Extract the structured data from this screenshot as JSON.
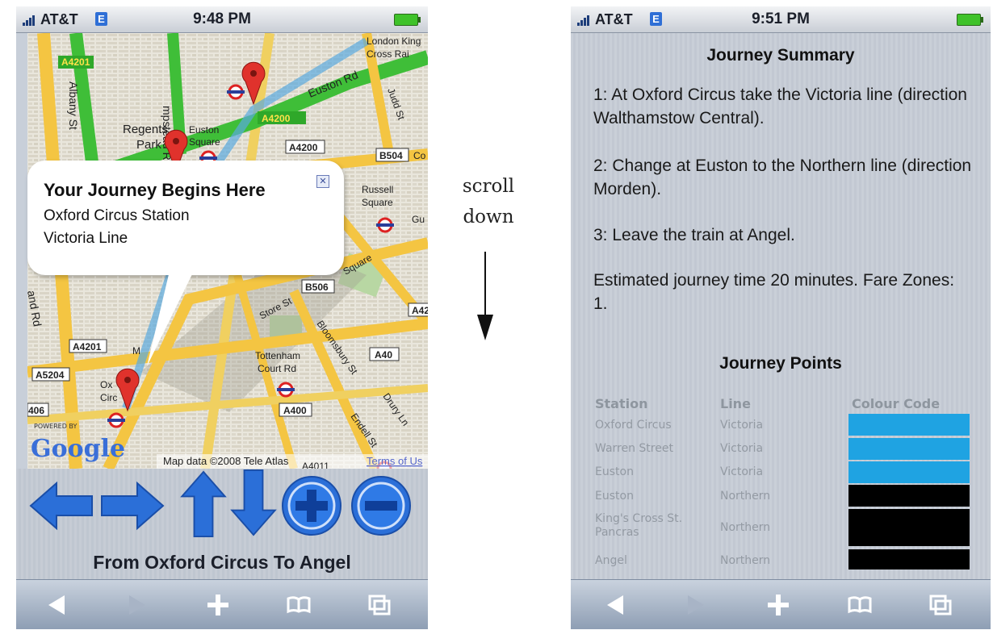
{
  "left_screen": {
    "status": {
      "carrier": "AT&T",
      "network": "E",
      "time": "9:48 PM"
    },
    "map_labels": {
      "a4201_top": "A4201",
      "hampstead": "mpstead Rd",
      "albany": "Albany St",
      "kings_cross": "London King",
      "kings_cross2": "Cross Rai",
      "euston_rd": "Euston Rd",
      "a4200_a": "A4200",
      "a4200_b": "A4200",
      "judd": "Judd St",
      "regents": "Regents",
      "park": "Park",
      "euston_sq": "Euston",
      "euston_sq2": "Square",
      "b504": "B504",
      "co": "Co",
      "russell": "Russell",
      "russell2": "Square",
      "gu": "Gu",
      "b506": "B506",
      "store_st": "Store St",
      "bloomsbury": "Bloomsbury St",
      "a4201_b": "A4201",
      "a42": "A42",
      "a5204": "A5204",
      "tcr": "Tottenham",
      "tcr2": "Court Rd",
      "a40": "A40",
      "a400": "A400",
      "r406": "406",
      "drury": "Drury Ln",
      "endell": "Endell St",
      "oxf": "Ox",
      "circ": "Circ",
      "bedford_sq": "Square",
      "m": "M",
      "and_rd": "and Rd",
      "powered": "POWERED BY",
      "google": "Google",
      "copyright": "Map data ©2008 Tele Atlas",
      "terms": "Terms of Us",
      "a4011": "A4011"
    },
    "callout": {
      "title": "Your Journey Begins Here",
      "line1": "Oxford Circus Station",
      "line2": "Victoria Line",
      "close": "✕"
    },
    "controls": [
      "arrow-left",
      "arrow-right",
      "arrow-up",
      "arrow-down",
      "zoom-in",
      "zoom-out"
    ],
    "caption": "From Oxford Circus To Angel"
  },
  "scroll_hint": {
    "line1": "scroll",
    "line2": "down"
  },
  "right_screen": {
    "status": {
      "carrier": "AT&T",
      "network": "E",
      "time": "9:51 PM"
    },
    "summary_title": "Journey Summary",
    "steps": [
      "1: At Oxford Circus take the Victoria line (direction Walthamstow Central).",
      "2: Change at Euston to the Northern line (direction Morden).",
      "3: Leave the train at Angel."
    ],
    "estimate": "Estimated journey time 20 minutes. Fare Zones: 1.",
    "points_title": "Journey Points",
    "table_headers": {
      "station": "Station",
      "line": "Line",
      "colour": "Colour Code"
    },
    "rows": [
      {
        "station": "Oxford Circus",
        "line": "Victoria",
        "color": "#1fa3e2"
      },
      {
        "station": "Warren Street",
        "line": "Victoria",
        "color": "#1fa3e2"
      },
      {
        "station": "Euston",
        "line": "Victoria",
        "color": "#1fa3e2"
      },
      {
        "station": "Euston",
        "line": "Northern",
        "color": "#000000"
      },
      {
        "station": "King's Cross St. Pancras",
        "line": "Northern",
        "color": "#000000"
      },
      {
        "station": "Angel",
        "line": "Northern",
        "color": "#000000"
      }
    ]
  },
  "toolbar_icons": [
    "back-icon",
    "forward-icon",
    "plus-icon",
    "bookmarks-icon",
    "pages-icon"
  ],
  "colors": {
    "victoria": "#1fa3e2",
    "northern": "#000000",
    "button_blue": "#2b6fd8",
    "pin_red": "#e0322c"
  }
}
